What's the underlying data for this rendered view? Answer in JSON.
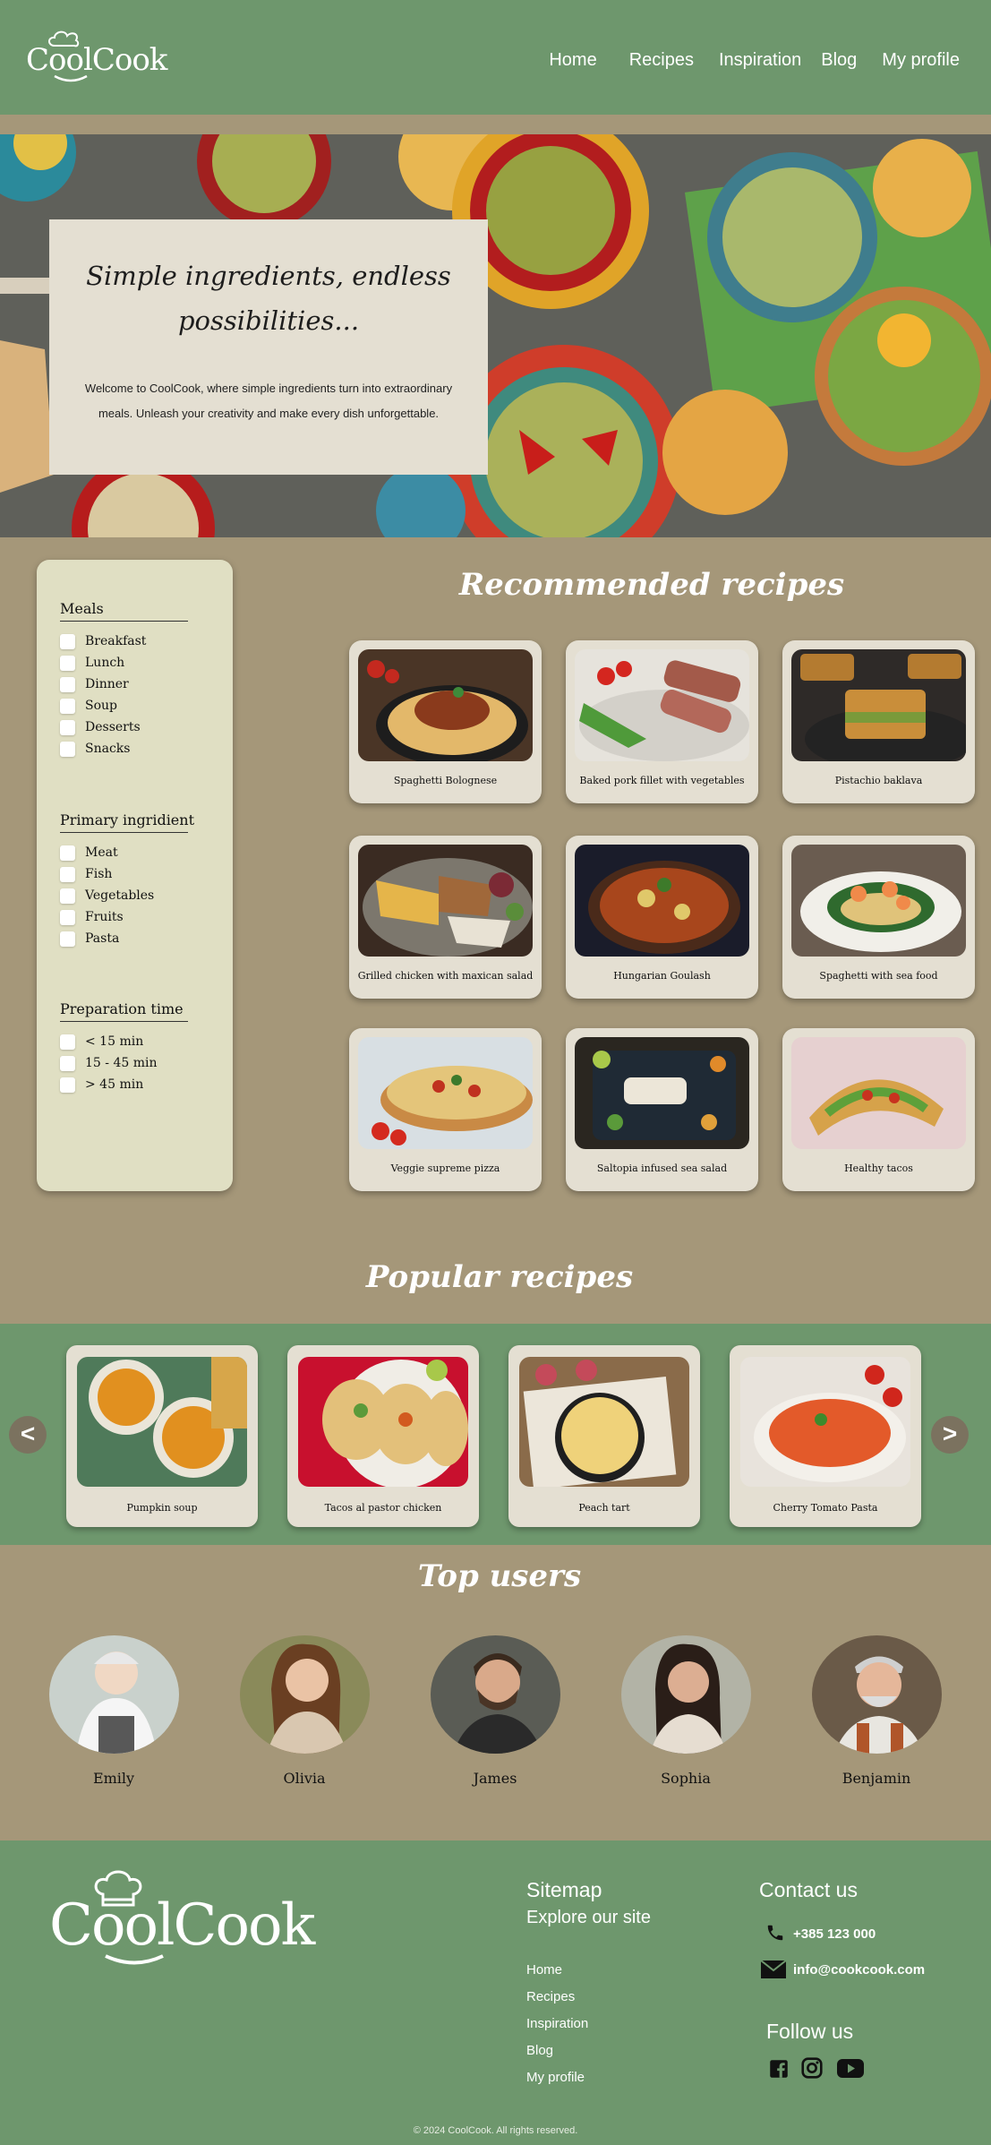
{
  "header": {
    "logo": "CoolCook",
    "nav": [
      "Home",
      "Recipes",
      "Inspiration",
      "Blog",
      "My profile"
    ]
  },
  "hero": {
    "title": "Simple ingredients, endless possibilities...",
    "text": "Welcome to CoolCook, where simple ingredients turn into extraordinary meals.  Unleash your creativity and make every dish unforgettable."
  },
  "filters": {
    "meals": {
      "title": "Meals",
      "options": [
        "Breakfast",
        "Lunch",
        "Dinner",
        "Soup",
        "Desserts",
        "Snacks"
      ]
    },
    "primary": {
      "title": "Primary ingridient",
      "options": [
        "Meat",
        "Fish",
        "Vegetables",
        "Fruits",
        "Pasta"
      ]
    },
    "time": {
      "title": "Preparation time",
      "options": [
        "< 15 min",
        "15 - 45 min",
        "> 45 min"
      ]
    }
  },
  "recommended": {
    "title": "Recommended recipes",
    "items": [
      "Spaghetti Bolognese",
      "Baked pork fillet with vegetables",
      "Pistachio baklava",
      "Grilled chicken with maxican salad",
      "Hungarian Goulash",
      "Spaghetti with sea food",
      "Veggie supreme pizza",
      "Saltopia infused sea salad",
      "Healthy tacos"
    ]
  },
  "popular": {
    "title": "Popular recipes",
    "items": [
      "Pumpkin soup",
      "Tacos al pastor chicken",
      "Peach tart",
      "Cherry Tomato Pasta"
    ],
    "prev": "<",
    "next": ">"
  },
  "users": {
    "title": "Top users",
    "items": [
      "Emily",
      "Olivia",
      "James",
      "Sophia",
      "Benjamin"
    ]
  },
  "footer": {
    "logo": "CoolCook",
    "sitemap_title": "Sitemap",
    "sitemap_sub": "Explore our site",
    "links": [
      "Home",
      "Recipes",
      "Inspiration",
      "Blog",
      "My profile"
    ],
    "contact_title": "Contact us",
    "phone": "+385 123 000",
    "email": "info@cookcook.com",
    "follow_title": "Follow us",
    "social_icons": [
      "facebook-icon",
      "instagram-icon",
      "youtube-icon"
    ],
    "copyright": "© 2024 CoolCook. All rights reserved."
  },
  "colors": {
    "green": "#6e976d",
    "tan": "#a59779",
    "card": "#e4dfd2",
    "panel": "#e0dfc3"
  }
}
